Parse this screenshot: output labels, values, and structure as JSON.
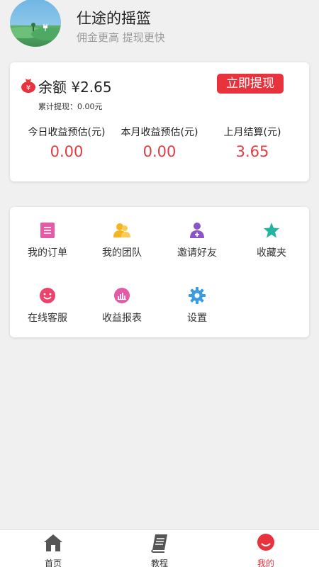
{
  "header": {
    "username": "仕途的摇篮",
    "subtitle": "佣金更高 提现更快"
  },
  "balance": {
    "label": "余额 ¥2.65",
    "currency_symbol": "¥",
    "withdraw_button": "立即提现",
    "cumulative_withdraw": "累计提现：0.00元",
    "stats": [
      {
        "label": "今日收益预估(元)",
        "value": "0.00"
      },
      {
        "label": "本月收益预估(元)",
        "value": "0.00"
      },
      {
        "label": "上月结算(元)",
        "value": "3.65"
      }
    ]
  },
  "menu": {
    "items": [
      {
        "label": "我的订单",
        "icon": "order-list-icon",
        "color": "#e45aa4"
      },
      {
        "label": "我的团队",
        "icon": "team-icon",
        "color": "#f5b520"
      },
      {
        "label": "邀请好友",
        "icon": "invite-friend-icon",
        "color": "#8a55c8"
      },
      {
        "label": "收藏夹",
        "icon": "star-icon",
        "color": "#23b5a0"
      },
      {
        "label": "在线客服",
        "icon": "smile-icon",
        "color": "#e8446c"
      },
      {
        "label": "收益报表",
        "icon": "bar-chart-icon",
        "color": "#e45aa4"
      },
      {
        "label": "设置",
        "icon": "gear-icon",
        "color": "#3a9be0"
      }
    ]
  },
  "bottom_nav": {
    "items": [
      {
        "label": "首页",
        "icon": "home-icon"
      },
      {
        "label": "教程",
        "icon": "book-icon"
      },
      {
        "label": "我的",
        "icon": "profile-smile-icon",
        "active": true
      }
    ]
  },
  "colors": {
    "accent": "#e8333d",
    "value_red": "#e03c44",
    "background": "#f0f0f0"
  }
}
